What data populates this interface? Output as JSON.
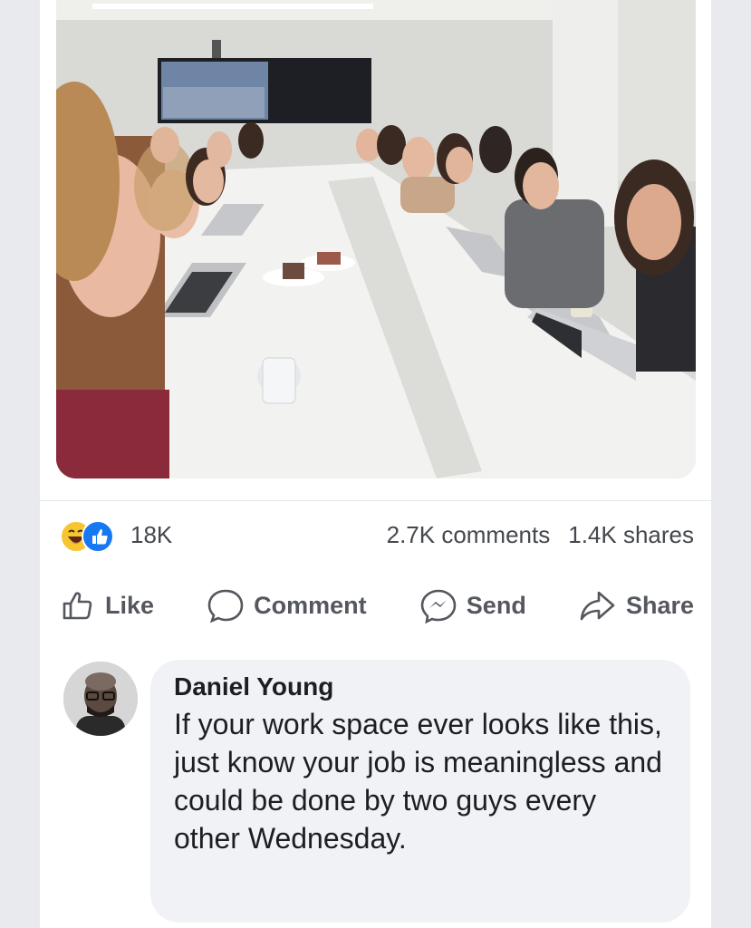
{
  "post": {
    "reaction_count": "18K",
    "comments_count": "2.7K comments",
    "shares_count": "1.4K shares",
    "reactions": [
      "haha-icon",
      "like-icon"
    ]
  },
  "actions": {
    "like_label": "Like",
    "comment_label": "Comment",
    "send_label": "Send",
    "share_label": "Share"
  },
  "comment": {
    "author": "Daniel Young",
    "text": "If your work space ever looks like this, just know your job is meaningless and could be done by two guys every other Wednesday."
  },
  "colors": {
    "like_blue": "#1877f2",
    "haha_yellow": "#f7c531",
    "bubble_bg": "#f0f2f5",
    "text_primary": "#1c1e21",
    "text_secondary": "#54575e"
  }
}
